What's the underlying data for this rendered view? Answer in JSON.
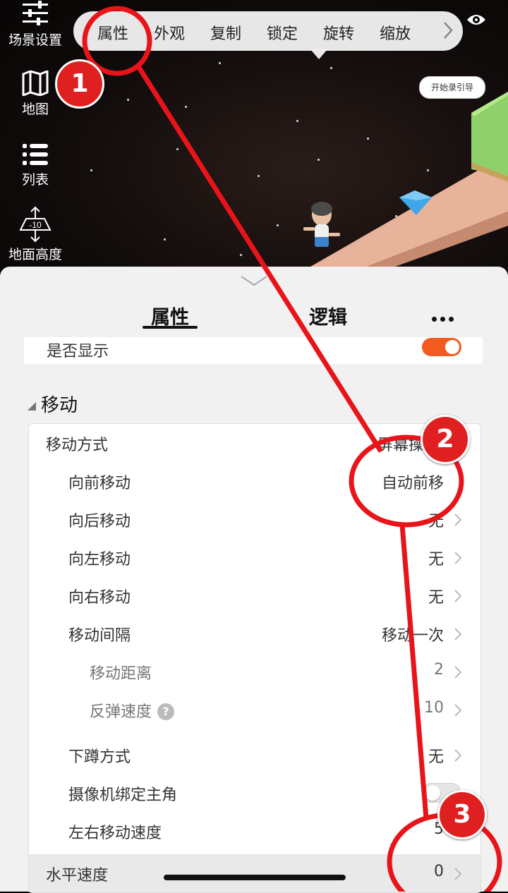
{
  "left_tools": [
    {
      "label": "场景设置",
      "icon": "sliders-icon"
    },
    {
      "label": "地图",
      "icon": "map-icon"
    },
    {
      "label": "列表",
      "icon": "list-icon"
    },
    {
      "label": "地面高度",
      "icon": "ground-height-icon",
      "badge": "-10"
    }
  ],
  "top_tabs": [
    "属性",
    "外观",
    "复制",
    "锁定",
    "旋转",
    "缩放"
  ],
  "record_button": "开始录引导",
  "panel": {
    "tabs": [
      "属性",
      "逻辑"
    ],
    "visible_row": {
      "label": "是否显示",
      "on": true
    },
    "section_title": "移动",
    "rows": [
      {
        "label": "移动方式",
        "value": "屏幕操",
        "level": 0,
        "chevron": false
      },
      {
        "label": "向前移动",
        "value": "自动前移",
        "level": 1,
        "chevron": false
      },
      {
        "label": "向后移动",
        "value": "无",
        "level": 1,
        "chevron": true
      },
      {
        "label": "向左移动",
        "value": "无",
        "level": 1,
        "chevron": true
      },
      {
        "label": "向右移动",
        "value": "无",
        "level": 1,
        "chevron": true
      },
      {
        "label": "移动间隔",
        "value": "移动一次",
        "level": 1,
        "chevron": true
      },
      {
        "label": "移动距离",
        "value": "2",
        "level": 2,
        "chevron": true
      },
      {
        "label": "反弹速度",
        "value": "10",
        "level": 2,
        "chevron": true,
        "help": "?"
      },
      {
        "label": "下蹲方式",
        "value": "无",
        "level": 1,
        "chevron": true
      },
      {
        "label": "摄像机绑定主角",
        "value": "",
        "level": 1,
        "toggle": false
      },
      {
        "label": "左右移动速度",
        "value": "5",
        "level": 1,
        "chevron": false
      },
      {
        "label": "水平速度",
        "value": "0",
        "level": 0,
        "chevron": true,
        "highlight": true
      }
    ]
  },
  "annotations": [
    "1",
    "2",
    "3"
  ],
  "colors": {
    "accent": "#f25a1f",
    "annotation": "#e02020"
  }
}
